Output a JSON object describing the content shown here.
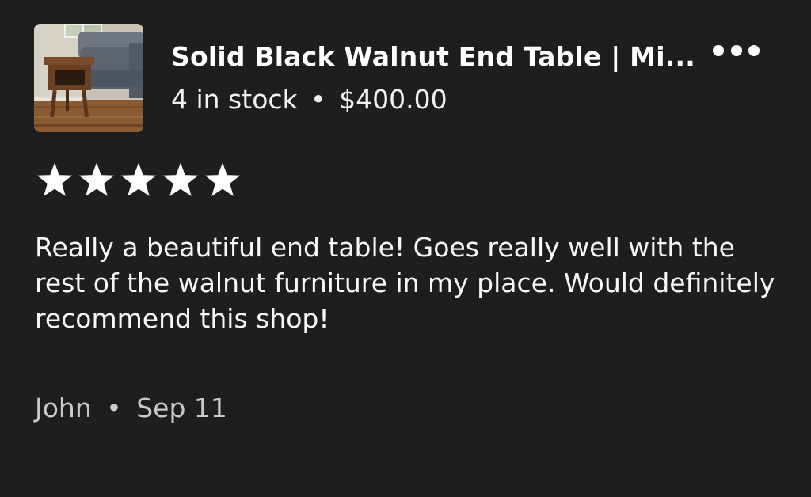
{
  "listing": {
    "title": "Solid Black Walnut End Table | Mi...",
    "stock": "4 in stock",
    "separator": "•",
    "price": "$400.00",
    "thumbnail_icon": "product-photo"
  },
  "actions": {
    "more_icon": "more-options-icon"
  },
  "rating": {
    "stars": 5,
    "max": 5,
    "color": "#ffffff"
  },
  "review": {
    "text": "Really a beautiful end table! Goes really well with the rest of the walnut furniture in my place. Would definitely recommend this shop!"
  },
  "author": {
    "name": "John",
    "separator": "•",
    "date": "Sep 11"
  },
  "colors": {
    "background": "#1e1e1e",
    "text": "#ffffff",
    "muted": "#c9c9c9"
  }
}
